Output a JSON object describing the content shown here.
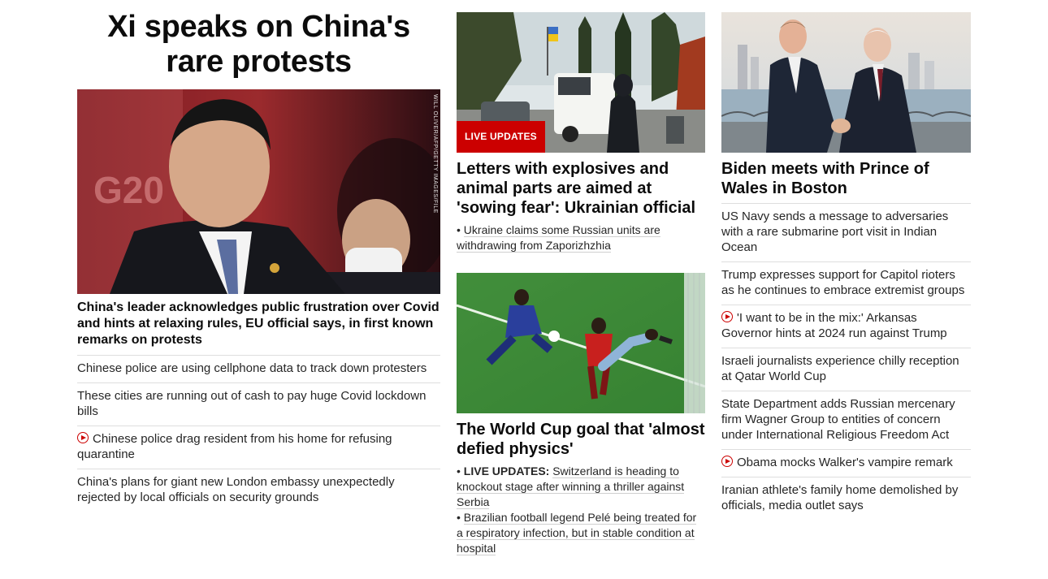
{
  "left": {
    "headline": "Xi speaks on China's rare protests",
    "photo_credit": "WILL OLIVER/AFP/GETTY IMAGES/FILE",
    "lead_title": "China's leader acknowledges public frustration over Covid and hints at relaxing rules, EU official says, in first known remarks on protests",
    "items": [
      {
        "text": "Chinese police are using cellphone data to track down protesters",
        "video": false
      },
      {
        "text": "These cities are running out of cash to pay huge Covid lockdown bills",
        "video": false
      },
      {
        "text": "Chinese police drag resident from his home for refusing quarantine",
        "video": true
      },
      {
        "text": "China's plans for giant new London embassy unexpectedly rejected by local officials on security grounds",
        "video": false
      }
    ]
  },
  "middle": {
    "card1": {
      "badge": "LIVE UPDATES",
      "title": "Letters with explosives and animal parts are aimed at 'sowing fear': Ukrainian official",
      "bullets": [
        "Ukraine claims some Russian units are withdrawing from Zaporizhzhia"
      ]
    },
    "card2": {
      "title": "The World Cup goal that 'almost defied physics'",
      "bullet1_label": "LIVE UPDATES:",
      "bullet1_text": "Switzerland is heading to knockout stage after winning a thriller against Serbia",
      "bullet2_text": "Brazilian football legend Pelé being treated for a respiratory infection, but in stable condition at hospital"
    }
  },
  "right": {
    "title": "Biden meets with Prince of Wales in Boston",
    "items": [
      {
        "text": "US Navy sends a message to adversaries with a rare submarine port visit in Indian Ocean",
        "video": false
      },
      {
        "text": "Trump expresses support for Capitol rioters as he continues to embrace extremist groups",
        "video": false
      },
      {
        "text": "'I want to be in the mix:' Arkansas Governor hints at 2024 run against Trump",
        "video": true
      },
      {
        "text": "Israeli journalists experience chilly reception at Qatar World Cup",
        "video": false
      },
      {
        "text": "State Department adds Russian mercenary firm Wagner Group to entities of concern under International Religious Freedom Act",
        "video": false
      },
      {
        "text": "Obama mocks Walker's vampire remark",
        "video": true
      },
      {
        "text": "Iranian athlete's family home demolished by officials, media outlet says",
        "video": false
      }
    ]
  },
  "colors": {
    "accent": "#cc0000",
    "text": "#0c0c0c",
    "divider": "#dedede"
  }
}
